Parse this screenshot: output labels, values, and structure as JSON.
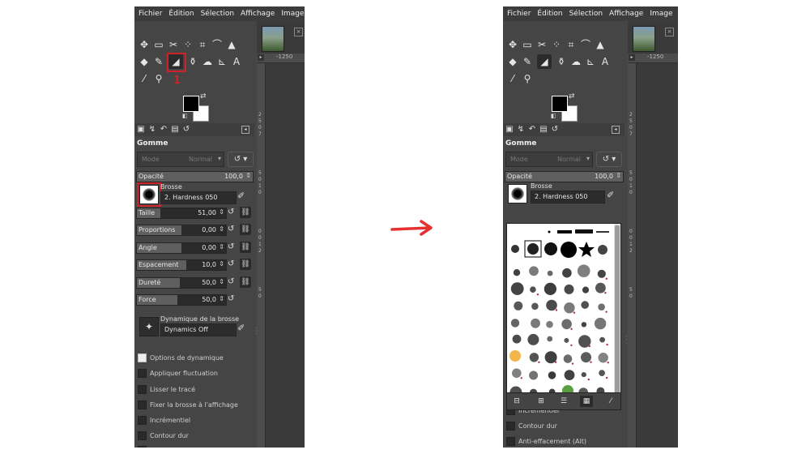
{
  "menu": [
    "Fichier",
    "Édition",
    "Sélection",
    "Affichage",
    "Image"
  ],
  "tool_icons": {
    "row1": [
      "move-icon",
      "rect-select-icon",
      "scissors-icon",
      "fuzzy-select-icon",
      "crop-icon",
      "warp-icon",
      "bucket-fill-icon"
    ],
    "row2": [
      "paint-fill-icon",
      "pencil-icon",
      "eraser-icon",
      "clone-icon",
      "smudge-icon",
      "measure-icon",
      "text-icon"
    ],
    "row3": [
      "color-picker-icon",
      "zoom-icon"
    ],
    "text_tool_glyph": "A"
  },
  "steps": {
    "one": "1",
    "two": "2"
  },
  "options": {
    "title": "Gomme",
    "mode_label": "Mode",
    "mode_value": "Normal",
    "opacity": {
      "label": "Opacité",
      "value": "100,0",
      "fraction": 1.0
    },
    "brush": {
      "label": "Brosse",
      "name": "2. Hardness 050"
    },
    "sliders": [
      {
        "label": "Taille",
        "value": "51,00",
        "fraction": 0.26
      },
      {
        "label": "Proportions",
        "value": "0,00",
        "fraction": 0.5
      },
      {
        "label": "Angle",
        "value": "0,00",
        "fraction": 0.5
      },
      {
        "label": "Espacement",
        "value": "10,0",
        "fraction": 0.55
      },
      {
        "label": "Dureté",
        "value": "50,0",
        "fraction": 0.48
      },
      {
        "label": "Force",
        "value": "50,0",
        "fraction": 0.45
      }
    ],
    "dynamics": {
      "label": "Dynamique de la brosse",
      "name": "Dynamics Off"
    },
    "checks": [
      {
        "label": "Options de dynamique",
        "checked": true
      },
      {
        "label": "Appliquer fluctuation",
        "checked": false
      },
      {
        "label": "Lisser le tracé",
        "checked": false
      },
      {
        "label": "Fixer la brosse à l'affichage",
        "checked": false
      },
      {
        "label": "Incrémentiel",
        "checked": false
      },
      {
        "label": "Contour dur",
        "checked": false
      },
      {
        "label": "Anti-effacement (Alt)",
        "checked": false
      }
    ]
  },
  "right_checks": [
    {
      "label": "Fixer la brosse à l'affichage"
    },
    {
      "label": "Incrémentiel"
    },
    {
      "label": "Contour dur"
    },
    {
      "label": "Anti-effacement (Alt)"
    }
  ],
  "ruler": {
    "h_mark": "-1250",
    "v_marks": [
      "2",
      "5",
      "0",
      "7",
      "5",
      "0",
      "1",
      "0",
      "0",
      "0",
      "1",
      "2",
      "5",
      "0"
    ]
  },
  "colors": {
    "highlight": "#d0202a",
    "arrow": "#e53030",
    "panel": "#454545"
  }
}
